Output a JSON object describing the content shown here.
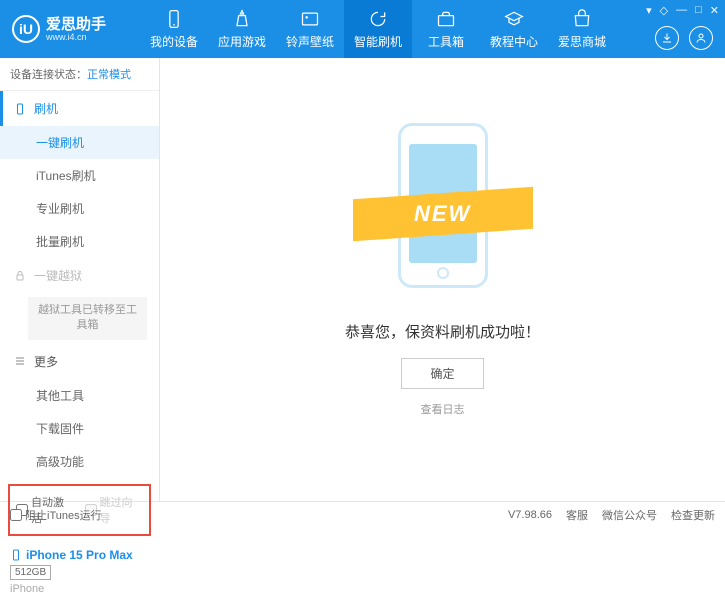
{
  "header": {
    "logo_letter": "iU",
    "logo_text": "爱思助手",
    "logo_sub": "www.i4.cn",
    "nav": [
      {
        "label": "我的设备"
      },
      {
        "label": "应用游戏"
      },
      {
        "label": "铃声壁纸"
      },
      {
        "label": "智能刷机"
      },
      {
        "label": "工具箱"
      },
      {
        "label": "教程中心"
      },
      {
        "label": "爱思商城"
      }
    ]
  },
  "sidebar": {
    "status_label": "设备连接状态：",
    "status_value": "正常模式",
    "flash_section": "刷机",
    "items": {
      "oneclick": "一键刷机",
      "itunes": "iTunes刷机",
      "pro": "专业刷机",
      "batch": "批量刷机"
    },
    "jailbreak_section": "一键越狱",
    "jailbreak_note": "越狱工具已转移至工具箱",
    "more_section": "更多",
    "more": {
      "other": "其他工具",
      "download": "下载固件",
      "advanced": "高级功能"
    },
    "cb_auto": "自动激活",
    "cb_skip": "跳过向导",
    "device": {
      "name": "iPhone 15 Pro Max",
      "cap": "512GB",
      "type": "iPhone"
    }
  },
  "main": {
    "ribbon": "NEW",
    "success": "恭喜您，保资料刷机成功啦！",
    "ok": "确定",
    "log": "查看日志"
  },
  "footer": {
    "block": "阻止iTunes运行",
    "version": "V7.98.66",
    "service": "客服",
    "wechat": "微信公众号",
    "update": "检查更新"
  }
}
